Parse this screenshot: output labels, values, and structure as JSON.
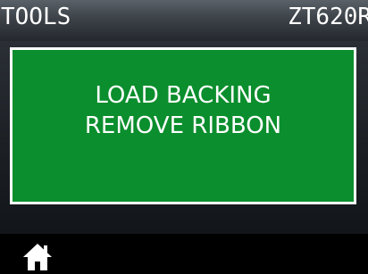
{
  "header": {
    "title": "TOOLS",
    "model": "ZT620R"
  },
  "message": {
    "line1": "LOAD BACKING",
    "line2": "REMOVE RIBBON"
  },
  "footer": {
    "home_icon": "home-icon"
  },
  "colors": {
    "message_background": "#0b8e2d",
    "message_border": "#ffffff",
    "text": "#ffffff"
  }
}
